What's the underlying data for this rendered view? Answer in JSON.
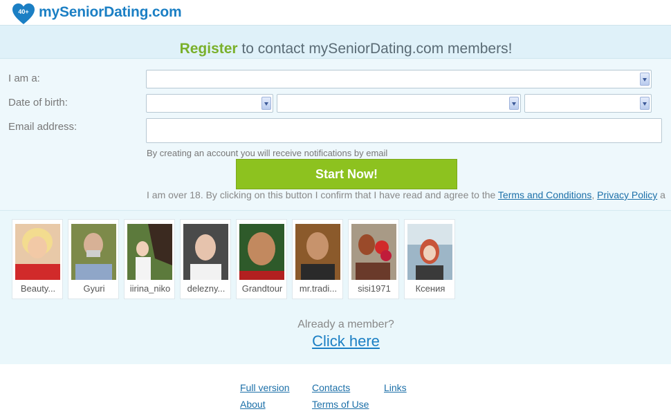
{
  "header": {
    "logo_badge": "40+",
    "logo_text": "mySeniorDating.com",
    "logo_color": "#1b7fc4"
  },
  "register": {
    "title_highlight": "Register",
    "title_rest": " to contact mySeniorDating.com members!"
  },
  "form": {
    "iam_label": "I am a:",
    "dob_label": "Date of birth:",
    "email_label": "Email address:",
    "iam_value": "",
    "dob_day": "",
    "dob_month": "",
    "dob_year": "",
    "email_value": "",
    "notice": "By creating an account you will receive notifications by email",
    "submit_label": "Start Now!",
    "legal_text": "I am over 18. By clicking on this button I confirm that I have read and agree to the ",
    "terms_link": "Terms and Conditions",
    "separator": ", ",
    "privacy_link": "Privacy Policy",
    "legal_tail": " a"
  },
  "profiles": [
    {
      "name": "Beauty..."
    },
    {
      "name": "Gyuri"
    },
    {
      "name": "iirina_niko"
    },
    {
      "name": "delezny..."
    },
    {
      "name": "Grandtour"
    },
    {
      "name": "mr.tradi..."
    },
    {
      "name": "sisi1971"
    },
    {
      "name": "Ксения"
    }
  ],
  "member": {
    "already_text": "Already a member?",
    "click_here": "Click here"
  },
  "footer": {
    "full_version": "Full version",
    "contacts": "Contacts",
    "links": "Links",
    "about": "About",
    "terms_of_use": "Terms of Use"
  },
  "colors": {
    "accent_green": "#8dc21f",
    "title_green": "#7ab02b",
    "link_blue": "#1b6fa8",
    "background": "#eaf7fb"
  }
}
